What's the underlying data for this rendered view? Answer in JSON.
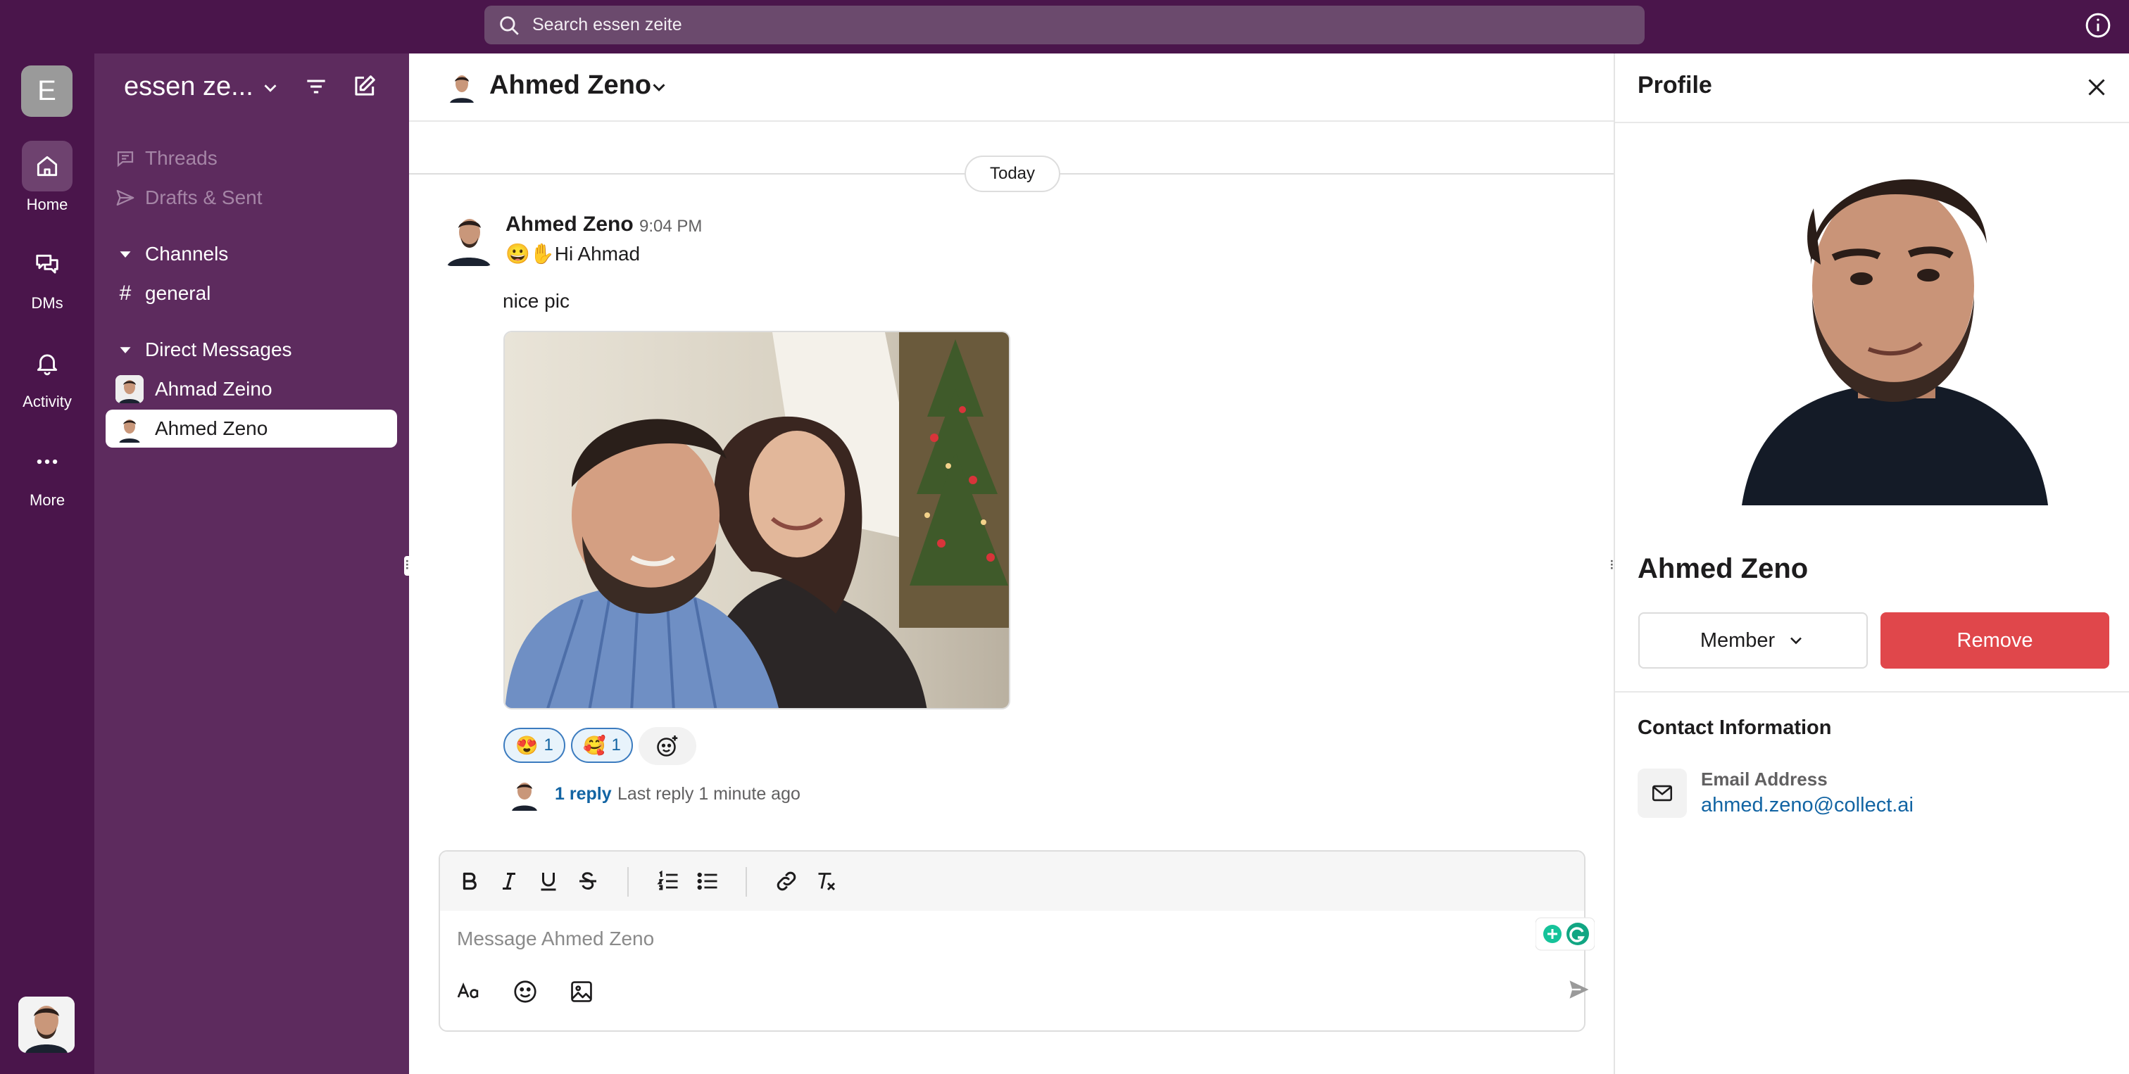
{
  "topbar": {
    "search_placeholder": "Search essen zeite"
  },
  "rail": {
    "workspace_initial": "E",
    "items": [
      {
        "label": "Home",
        "icon": "home-icon"
      },
      {
        "label": "DMs",
        "icon": "dms-icon"
      },
      {
        "label": "Activity",
        "icon": "bell-icon"
      },
      {
        "label": "More",
        "icon": "more-icon"
      }
    ]
  },
  "sidebar": {
    "workspace_name": "essen ze...",
    "threads": "Threads",
    "drafts": "Drafts & Sent",
    "channels_header": "Channels",
    "channels": [
      {
        "name": "general"
      }
    ],
    "dm_header": "Direct Messages",
    "dms": [
      {
        "name": "Ahmad Zeino"
      },
      {
        "name": "Ahmed Zeno",
        "active": true
      }
    ]
  },
  "conversation": {
    "title": "Ahmed Zeno",
    "day_divider": "Today",
    "message": {
      "author": "Ahmed Zeno",
      "time": "9:04 PM",
      "line1": "😀✋Hi Ahmad",
      "line2": "nice pic"
    },
    "reactions": [
      {
        "emoji": "😍",
        "count": "1"
      },
      {
        "emoji": "🥰",
        "count": "1"
      }
    ],
    "thread": {
      "replies": "1 reply",
      "last_reply": "Last reply 1 minute ago"
    }
  },
  "composer": {
    "placeholder": "Message Ahmed Zeno",
    "format_icons": [
      "bold-icon",
      "italic-icon",
      "underline-icon",
      "strikethrough-icon",
      "ordered-list-icon",
      "bullet-list-icon",
      "link-icon",
      "clear-format-icon"
    ]
  },
  "profile": {
    "title": "Profile",
    "name": "Ahmed Zeno",
    "role": "Member",
    "remove_label": "Remove",
    "contact_title": "Contact Information",
    "email_label": "Email Address",
    "email": "ahmed.zeno@collect.ai"
  },
  "colors": {
    "aubergine": "#4a154b",
    "sidebar": "#5d2b5e",
    "link": "#1264a3",
    "danger": "#e0474b"
  }
}
